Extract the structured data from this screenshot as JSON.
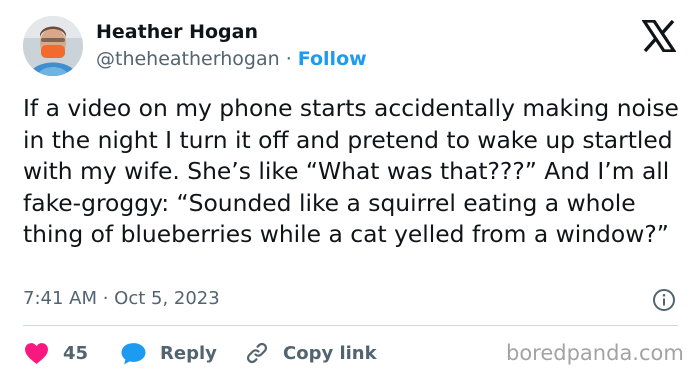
{
  "author": {
    "name": "Heather Hogan",
    "handle": "@theheatherhogan",
    "separator": "·",
    "follow_label": "Follow"
  },
  "tweet": {
    "text": "If a video on my phone starts accidentally making noise in the night I turn it off and pretend to wake up startled with my wife. She’s like “What was that???” And I’m all fake-groggy: “Sounded like a squirrel eating a whole thing of blueberries while a cat yelled from a window?”",
    "timestamp": "7:41 AM · Oct 5, 2023"
  },
  "actions": {
    "like_count": "45",
    "reply_label": "Reply",
    "copy_link_label": "Copy link"
  },
  "watermark": "boredpanda.com",
  "icons": {
    "logo": "x-logo-icon",
    "info": "info-icon",
    "like": "heart-icon",
    "reply": "speech-bubble-icon",
    "copy": "link-icon"
  },
  "colors": {
    "follow": "#1d9bf0",
    "like": "#f91880",
    "reply": "#1d9bf0",
    "copy_icon": "#1d9bf0",
    "secondary_text": "#536471",
    "watermark": "#a3a3a3"
  }
}
